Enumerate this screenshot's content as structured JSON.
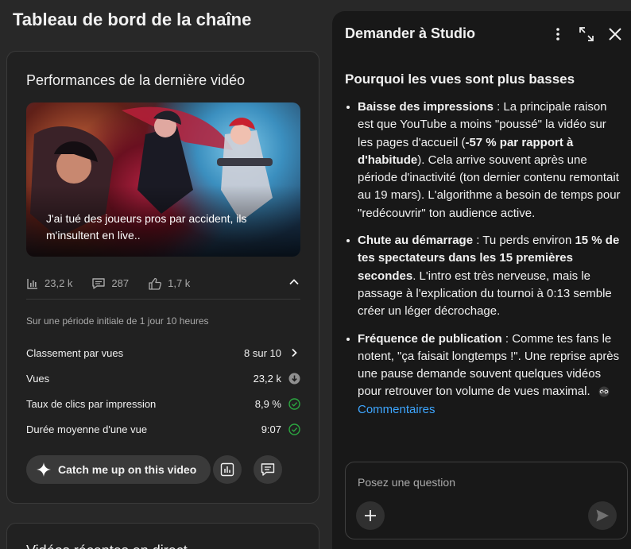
{
  "page": {
    "title": "Tableau de bord de la chaîne"
  },
  "latest_video": {
    "title": "Performances de la dernière vidéo",
    "thumbnail_caption": "J'ai tué des joueurs pros par accident, ils m'insultent en live..",
    "stats": {
      "views": "23,2 k",
      "comments": "287",
      "likes": "1,7 k"
    },
    "period": "Sur une période initiale de 1 jour 10 heures",
    "metrics": [
      {
        "label": "Classement par vues",
        "value": "8 sur 10",
        "icon": "chevron-right-icon"
      },
      {
        "label": "Vues",
        "value": "23,2 k",
        "icon": "arrow-down-circle-icon"
      },
      {
        "label": "Taux de clics par impression",
        "value": "8,9 %",
        "icon": "check-circle-icon"
      },
      {
        "label": "Durée moyenne d'une vue",
        "value": "9:07",
        "icon": "check-circle-icon"
      }
    ],
    "catch_up_label": "Catch me up on this video"
  },
  "next_card": {
    "title": "Vidéos  récentes  en direct"
  },
  "studio_panel": {
    "title": "Demander à Studio",
    "answer_title": "Pourquoi les vues sont plus basses",
    "bullets": [
      {
        "bold": "Baisse des impressions",
        "text_a": " : La principale raison est que YouTube a moins \"poussé\" la vidéo sur les pages d'accueil (",
        "bold2": "-57 % par rapport à d'habitude",
        "text_b": "). Cela arrive souvent après une période d'inactivité (ton dernier contenu remontait au 19 mars). L'algorithme a besoin de temps pour \"redécouvrir\" ton audience active."
      },
      {
        "bold": "Chute au démarrage",
        "text_a": " : Tu perds environ ",
        "bold2": "15 % de tes spectateurs dans les 15 premières secondes",
        "text_b": ". L'intro est très nerveuse, mais le passage à l'explication du tournoi à 0:13 semble créer un léger décrochage."
      },
      {
        "bold": "Fréquence de publication",
        "text_a": " : Comme tes fans le notent, \"ça faisait longtemps !\". Une reprise après une pause demande souvent quelques vidéos pour retrouver ton volume de vues maximal. ",
        "link": "Commentaires"
      }
    ],
    "input_placeholder": "Posez une question"
  },
  "colors": {
    "accent_link": "#3ea6ff",
    "check_green": "#2ba640",
    "background": "#282828",
    "panel": "#181818"
  }
}
